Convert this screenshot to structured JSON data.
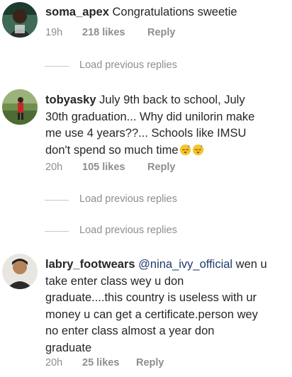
{
  "comments": [
    {
      "username": "soma_apex",
      "text": "Congratulations sweetie",
      "time": "19h",
      "likes": "218 likes",
      "reply": "Reply",
      "avatar_icon": "avatar-photo"
    },
    {
      "username": "tobyasky",
      "text_lines": [
        "July 9th back to school,  July",
        "30th graduation... Why did unilorin make",
        "me use 4 years??... Schools like IMSU",
        "don't spend so much time"
      ],
      "emojis": [
        "sleeping-face-emoji",
        "sleeping-face-emoji"
      ],
      "time": "20h",
      "likes": "105 likes",
      "reply": "Reply",
      "avatar_icon": "avatar-photo"
    },
    {
      "username": "labry_footwears",
      "mention": "@nina_ivy_official",
      "text_lines": [
        "wen u",
        "take enter class wey u don",
        "graduate....this country is useless with ur",
        "money u can get a certificate.person wey",
        "no enter class almost a year don",
        "graduate"
      ],
      "time": "20h",
      "likes": "25 likes",
      "reply": "Reply",
      "avatar_icon": "avatar-photo"
    }
  ],
  "load_previous": [
    {
      "label": "Load previous replies"
    },
    {
      "label": "Load previous replies"
    },
    {
      "label": "Load previous replies"
    }
  ],
  "colors": {
    "text": "#262626",
    "meta": "#8e8e8e",
    "mention": "#1e3a6e",
    "divider": "#c7c7c7"
  }
}
